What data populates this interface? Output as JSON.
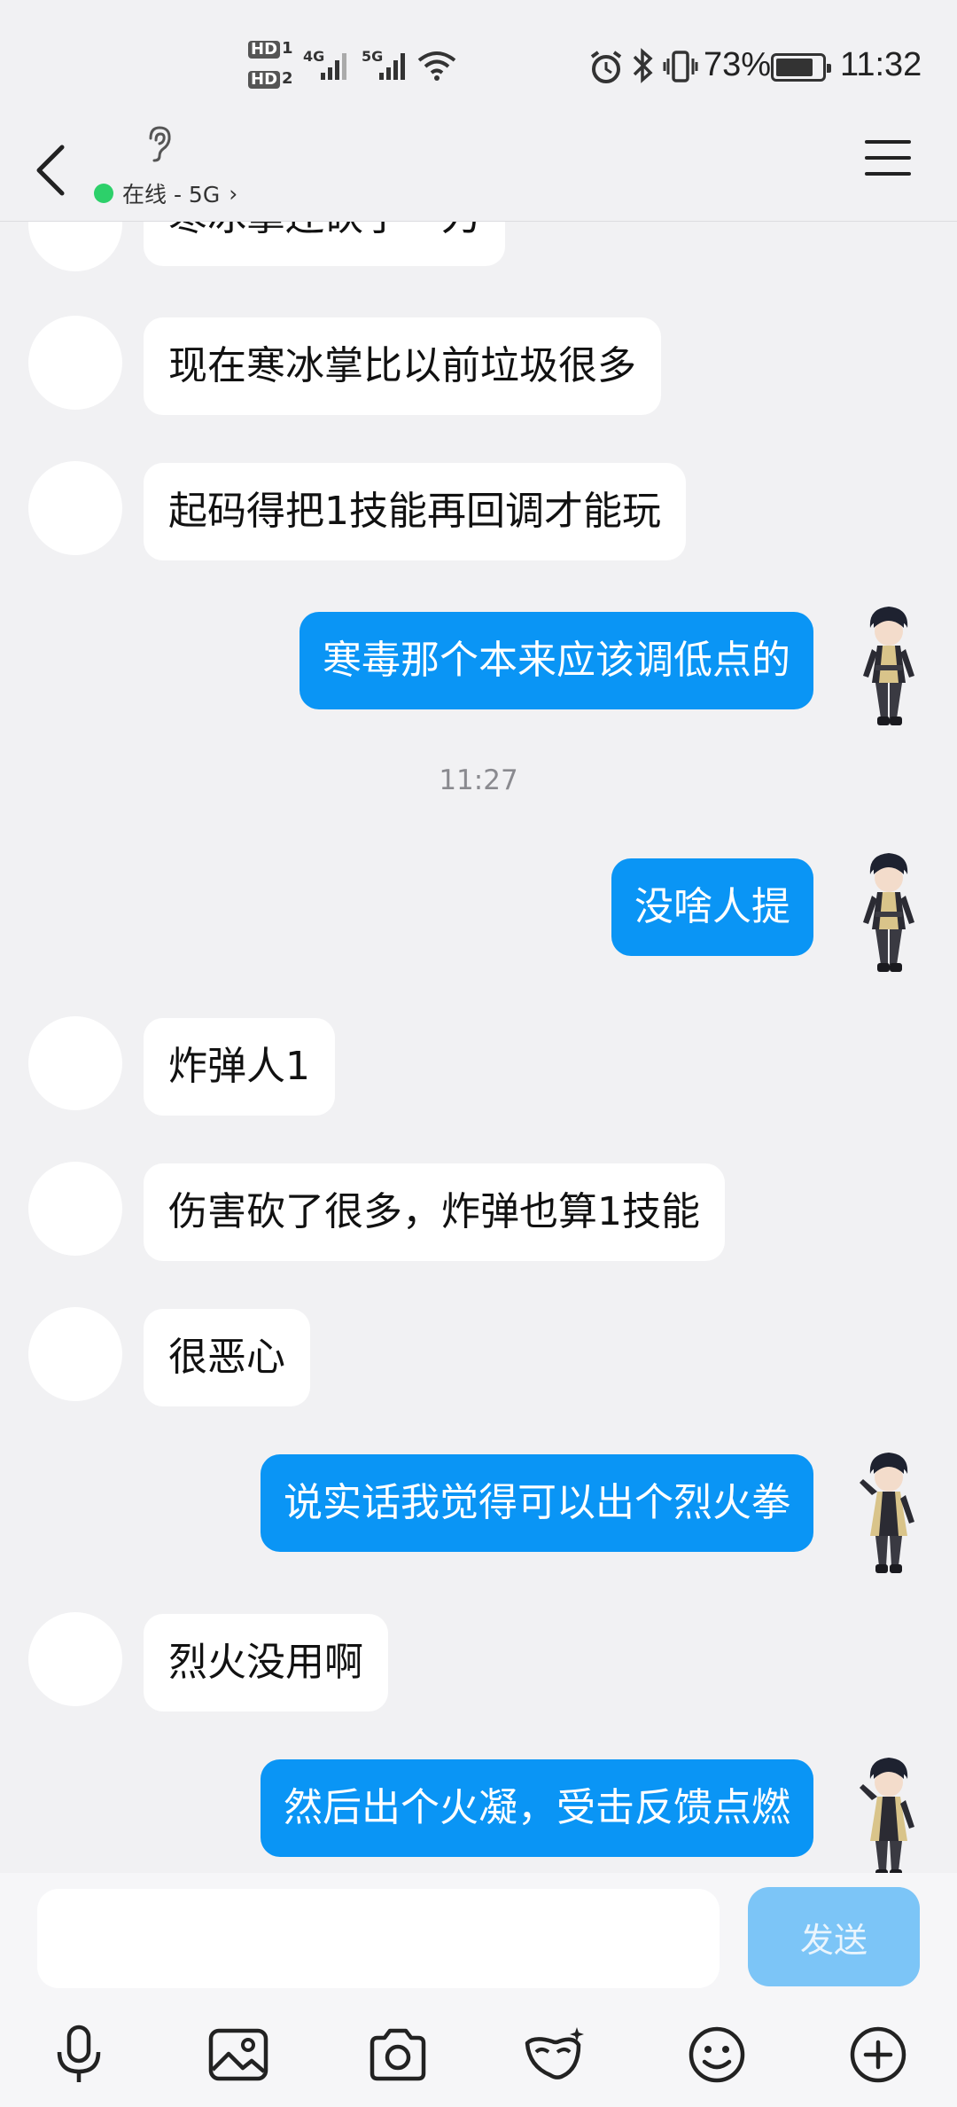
{
  "status_bar": {
    "hd1": "HD",
    "sim1": "1",
    "hd2": "HD",
    "sim2": "2",
    "net1": "4G",
    "net2": "5G",
    "battery_pct": "73%",
    "battery_level": 0.73,
    "time": "11:32",
    "icons": [
      "alarm-icon",
      "bluetooth-icon",
      "vibrate-icon",
      "wifi-icon",
      "signal-icon",
      "battery-icon"
    ]
  },
  "header": {
    "online_status": "在线 - 5G",
    "chevron": "›",
    "icons": [
      "back-icon",
      "ear-icon",
      "menu-icon"
    ]
  },
  "messages": [
    {
      "side": "in",
      "text": "寒冰掌还砍了一刀"
    },
    {
      "side": "in",
      "text": "现在寒冰掌比以前垃圾很多"
    },
    {
      "side": "in",
      "text": "起码得把1技能再回调才能玩"
    },
    {
      "side": "out",
      "text": "寒毒那个本来应该调低点的"
    },
    {
      "side": "time",
      "text": "11:27"
    },
    {
      "side": "out",
      "text": "没啥人提"
    },
    {
      "side": "in",
      "text": "炸弹人1"
    },
    {
      "side": "in",
      "text": "伤害砍了很多，炸弹也算1技能"
    },
    {
      "side": "in",
      "text": "很恶心"
    },
    {
      "side": "out",
      "text": "说实话我觉得可以出个烈火拳"
    },
    {
      "side": "in",
      "text": "烈火没用啊"
    },
    {
      "side": "out",
      "text": "然后出个火凝，受击反馈点燃"
    }
  ],
  "composer": {
    "input_value": "",
    "send_label": "发送"
  },
  "toolbar": {
    "icons": [
      "microphone-icon",
      "image-icon",
      "camera-icon",
      "mask-icon",
      "emoji-icon",
      "plus-icon"
    ]
  },
  "colors": {
    "outgoing_bubble": "#0a95f5",
    "incoming_bubble": "#ffffff",
    "background": "#f1f1f3",
    "online_dot": "#2dd06a",
    "send_button": "#7cc5f7"
  }
}
